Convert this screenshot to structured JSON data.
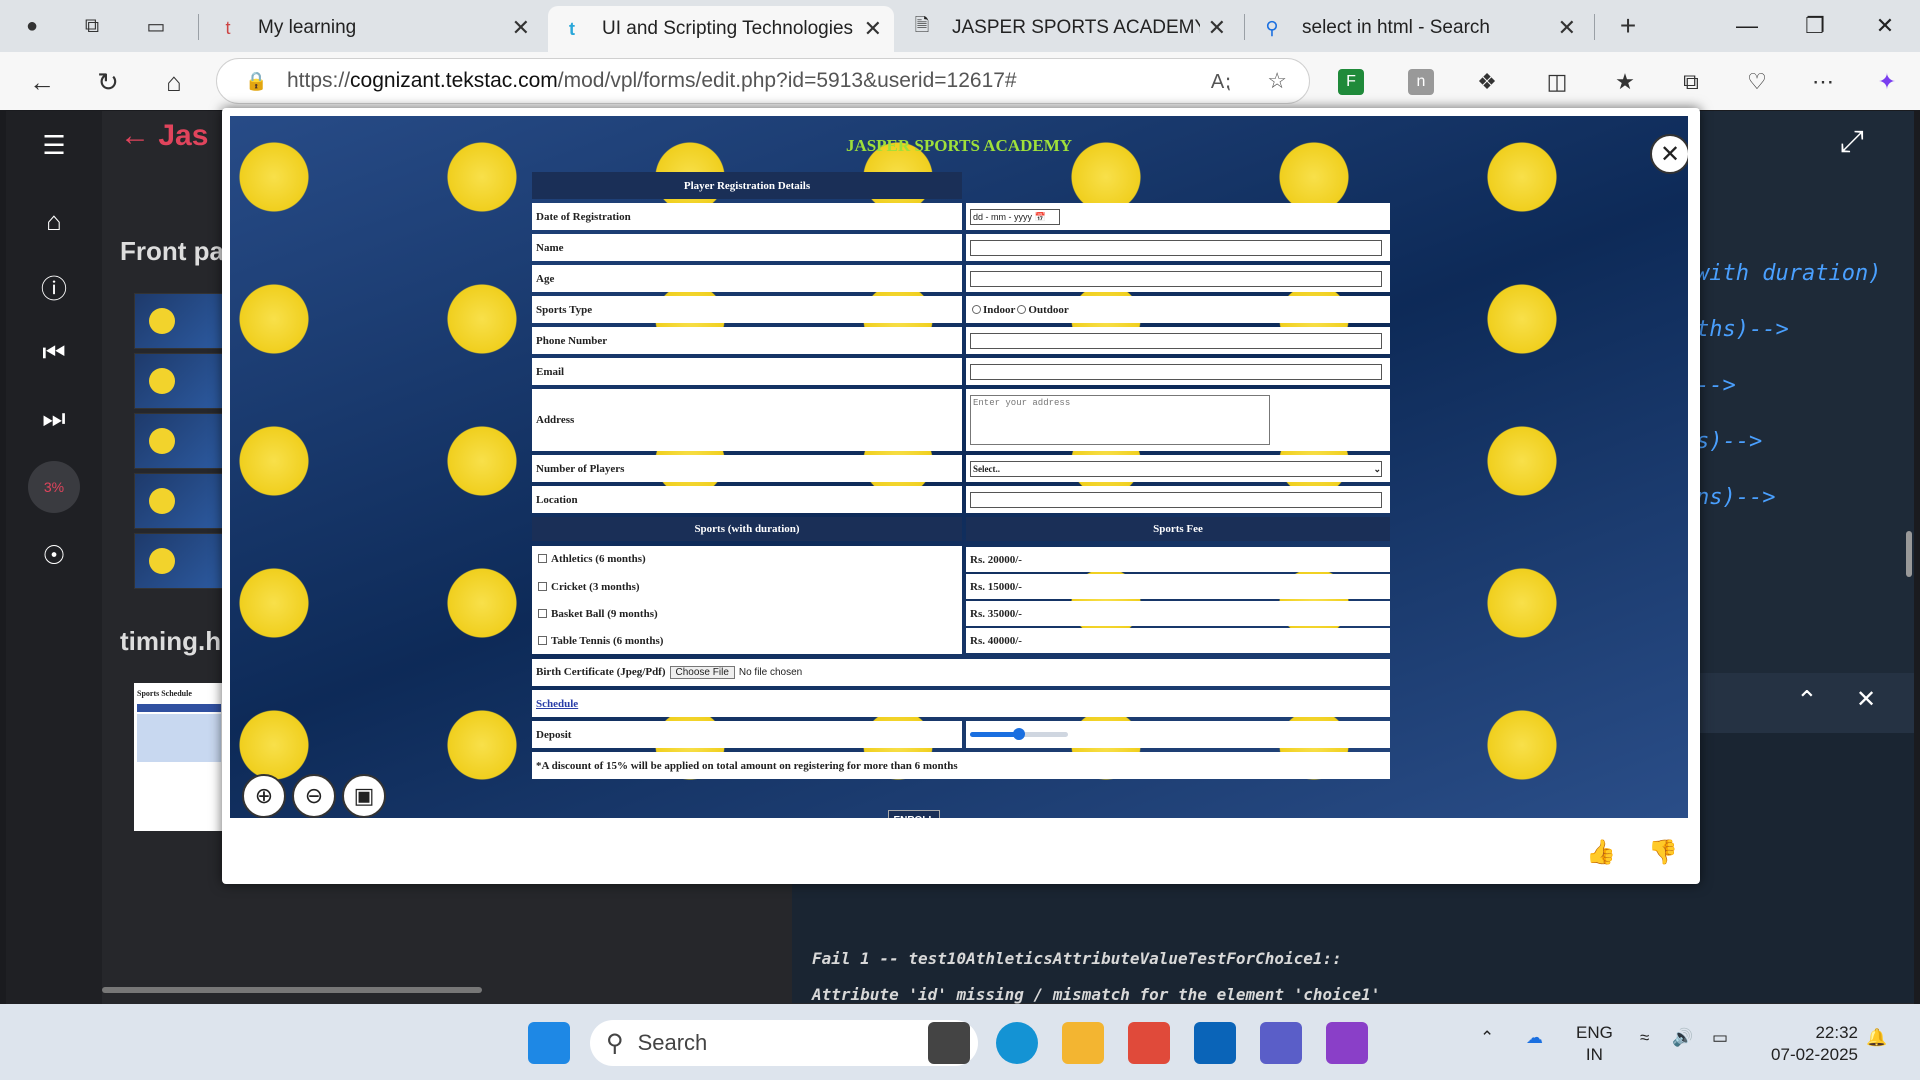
{
  "browser": {
    "tabs": [
      {
        "label": "My learning",
        "icon": "learning-icon"
      },
      {
        "label": "UI and Scripting Technologies Ja",
        "icon": "tekstac-icon"
      },
      {
        "label": "JASPER SPORTS ACADEMY",
        "icon": "page-icon"
      },
      {
        "label": "select in html - Search",
        "icon": "search-icon"
      }
    ],
    "url_prefix": "https://",
    "url_host": "cognizant.tekstac.com",
    "url_path": "/mod/vpl/forms/edit.php?id=5913&userid=12617#"
  },
  "background_page": {
    "title": "Jas",
    "progress": "3%",
    "section_front": "Front pa",
    "section_timing": "timing.h",
    "schedule_thumb_title": "Sports Schedule",
    "code_lines": [
      "with duration)",
      "ths)-->",
      "-->",
      "s)-->",
      "ns)-->"
    ],
    "test_output": [
      "Fail 1 -- test10AthleticsAttributeValueTestForChoice1::",
      "Attribute 'id' missing / mismatch for the element  'choice1'"
    ]
  },
  "modal": {
    "site_title": "JASPER SPORTS ACADEMY",
    "form_header": "Player Registration Details",
    "fields": {
      "date_label": "Date of Registration",
      "date_placeholder": "dd - mm - yyyy",
      "name_label": "Name",
      "age_label": "Age",
      "sports_type_label": "Sports Type",
      "indoor": "Indoor",
      "outdoor": "Outdoor",
      "phone_label": "Phone Number",
      "email_label": "Email",
      "address_label": "Address",
      "address_placeholder": "Enter your address",
      "players_label": "Number of Players",
      "players_selected": "Select..",
      "location_label": "Location"
    },
    "sports_header": "Sports (with duration)",
    "fee_header": "Sports Fee",
    "sports": [
      {
        "name": "Athletics (6 months)",
        "fee": "Rs. 20000/-"
      },
      {
        "name": "Cricket (3 months)",
        "fee": "Rs. 15000/-"
      },
      {
        "name": "Basket Ball (9 months)",
        "fee": "Rs. 35000/-"
      },
      {
        "name": "Table Tennis (6 months)",
        "fee": "Rs. 40000/-"
      }
    ],
    "birth_cert_label": "Birth Certificate (Jpeg/Pdf)",
    "choose_file": "Choose File",
    "no_file": "No file chosen",
    "schedule_link": "Schedule",
    "deposit_label": "Deposit",
    "deposit_value": 0.5,
    "discount_note": "*A discount of 15% will be applied on total amount on registering for more than 6 months",
    "enroll_label": "ENROLL"
  },
  "taskbar": {
    "search_label": "Search",
    "lang": "ENG",
    "region": "IN",
    "time": "22:32",
    "date": "07-02-2025"
  }
}
